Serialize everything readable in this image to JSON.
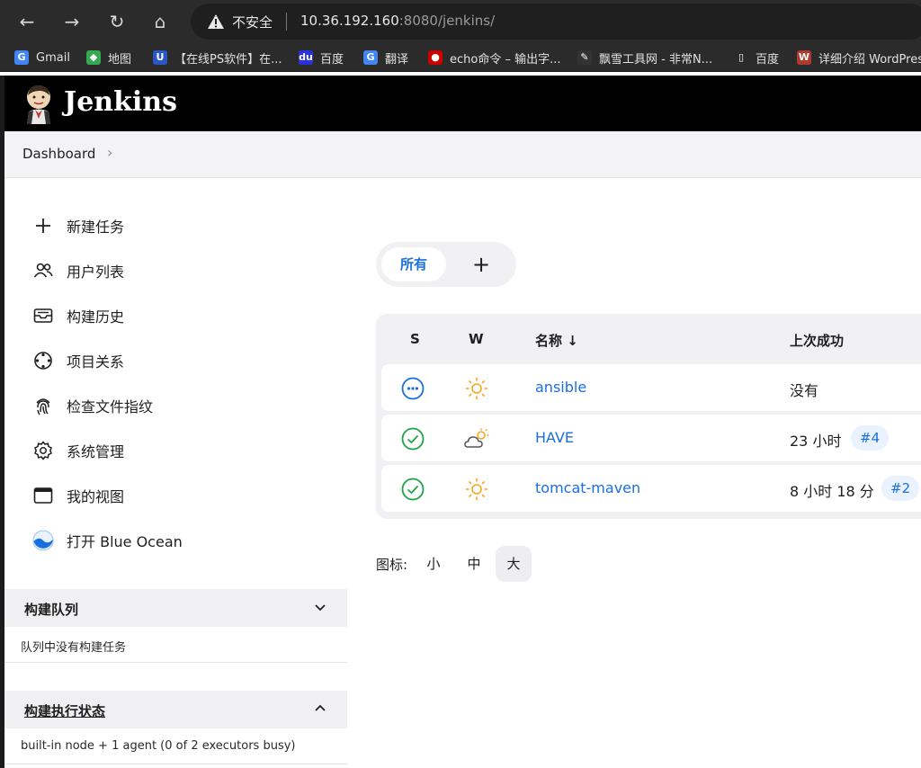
{
  "browser": {
    "back_label": "←",
    "forward_label": "→",
    "reload_label": "↻",
    "home_label": "⌂",
    "insecure_label": "不安全",
    "url_host": "10.36.192.160",
    "url_rest": ":8080/jenkins/",
    "bookmarks": [
      {
        "label": "Gmail",
        "icon": "gmail-icon",
        "glyph": "G",
        "color": "#4285f4"
      },
      {
        "label": "地图",
        "icon": "maps-icon",
        "glyph": "◆",
        "color": "#34a853"
      },
      {
        "label": "【在线PS软件】在...",
        "icon": "ps-icon",
        "glyph": "U",
        "color": "#2a56c6"
      },
      {
        "label": "百度",
        "icon": "baidu-icon",
        "glyph": "du",
        "color": "#2932e1"
      },
      {
        "label": "翻译",
        "icon": "translate-icon",
        "glyph": "G",
        "color": "#4285f4"
      },
      {
        "label": "echo命令 – 输出字...",
        "icon": "redhat-icon",
        "glyph": "●",
        "color": "#cc0000"
      },
      {
        "label": "飘雪工具网 - 非常N...",
        "icon": "piaoxue-icon",
        "glyph": "✎",
        "color": "#333333"
      },
      {
        "label": "百度",
        "icon": "page-icon",
        "glyph": "▯",
        "color": "#2b2b2b"
      },
      {
        "label": "详细介绍 WordPres",
        "icon": "wordpress-icon",
        "glyph": "W",
        "color": "#b03a2e"
      }
    ]
  },
  "header": {
    "title": "Jenkins"
  },
  "breadcrumb": {
    "dashboard": "Dashboard",
    "chevron": "›"
  },
  "sidebar": {
    "items": [
      {
        "label": "新建任务",
        "icon": "plus-icon"
      },
      {
        "label": "用户列表",
        "icon": "users-icon"
      },
      {
        "label": "构建历史",
        "icon": "history-icon"
      },
      {
        "label": "项目关系",
        "icon": "relationship-icon"
      },
      {
        "label": "检查文件指纹",
        "icon": "fingerprint-icon"
      },
      {
        "label": "系统管理",
        "icon": "gear-icon"
      },
      {
        "label": "我的视图",
        "icon": "window-icon"
      },
      {
        "label": "打开 Blue Ocean",
        "icon": "blue-ocean-icon"
      }
    ],
    "queue": {
      "title": "构建队列",
      "body": "队列中没有构建任务"
    },
    "executors": {
      "title": "构建执行状态",
      "body": "built-in node + 1 agent (0 of 2 executors busy)"
    }
  },
  "views": {
    "all": "所有",
    "add": "+"
  },
  "table": {
    "headers": {
      "s": "S",
      "w": "W",
      "name": "名称 ↓",
      "last_success": "上次成功"
    },
    "rows": [
      {
        "status": "pending",
        "weather": "sunny",
        "name": "ansible",
        "last_success": "没有",
        "build": ""
      },
      {
        "status": "success",
        "weather": "cloudy",
        "name": "HAVE",
        "last_success": "23 小时",
        "build": "#4"
      },
      {
        "status": "success",
        "weather": "sunny",
        "name": "tomcat-maven",
        "last_success": "8 小时 18 分",
        "build": "#2"
      }
    ]
  },
  "icon_size": {
    "label": "图标:",
    "small": "小",
    "medium": "中",
    "large": "大",
    "selected": "大"
  },
  "colors": {
    "link": "#1a6fe0",
    "success": "#1ea446",
    "sun": "#f5a623",
    "header_bg": "#000000"
  }
}
